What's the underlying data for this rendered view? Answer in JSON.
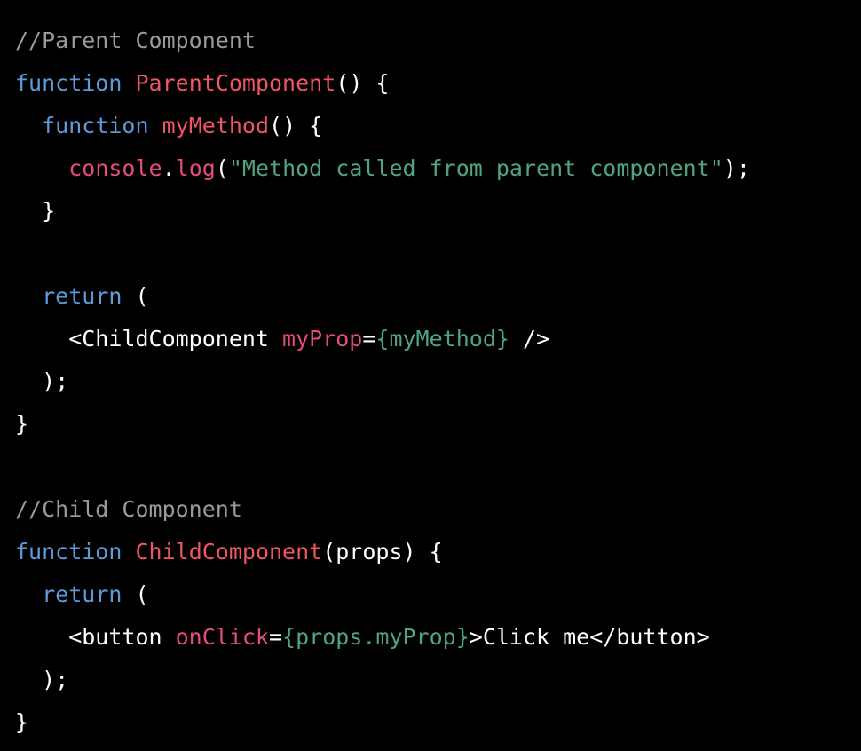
{
  "theme": {
    "background": "#000000",
    "colors": {
      "comment": "#9a9a9a",
      "keyword": "#5d9bd8",
      "function_name": "#ef5562",
      "builtin": "#e44c7c",
      "string": "#4fa481",
      "plain": "#ffffff"
    }
  },
  "code": {
    "language": "javascript",
    "lines": [
      [
        {
          "t": "//Parent Component",
          "k": "comment"
        }
      ],
      [
        {
          "t": "function",
          "k": "keyword"
        },
        {
          "t": " ",
          "k": "plain"
        },
        {
          "t": "ParentComponent",
          "k": "function_name"
        },
        {
          "t": "() {",
          "k": "plain"
        }
      ],
      [
        {
          "t": "  ",
          "k": "plain"
        },
        {
          "t": "function",
          "k": "keyword"
        },
        {
          "t": " ",
          "k": "plain"
        },
        {
          "t": "myMethod",
          "k": "function_name"
        },
        {
          "t": "() {",
          "k": "plain"
        }
      ],
      [
        {
          "t": "    ",
          "k": "plain"
        },
        {
          "t": "console",
          "k": "builtin"
        },
        {
          "t": ".",
          "k": "plain"
        },
        {
          "t": "log",
          "k": "builtin"
        },
        {
          "t": "(",
          "k": "plain"
        },
        {
          "t": "\"Method called from parent component\"",
          "k": "string"
        },
        {
          "t": ");",
          "k": "plain"
        }
      ],
      [
        {
          "t": "  }",
          "k": "plain"
        }
      ],
      [],
      [
        {
          "t": "  ",
          "k": "plain"
        },
        {
          "t": "return",
          "k": "keyword"
        },
        {
          "t": " (",
          "k": "plain"
        }
      ],
      [
        {
          "t": "    <ChildComponent ",
          "k": "plain"
        },
        {
          "t": "myProp",
          "k": "builtin"
        },
        {
          "t": "=",
          "k": "plain"
        },
        {
          "t": "{myMethod}",
          "k": "string"
        },
        {
          "t": " />",
          "k": "plain"
        }
      ],
      [
        {
          "t": "  );",
          "k": "plain"
        }
      ],
      [
        {
          "t": "}",
          "k": "plain"
        }
      ],
      [],
      [
        {
          "t": "//Child Component",
          "k": "comment"
        }
      ],
      [
        {
          "t": "function",
          "k": "keyword"
        },
        {
          "t": " ",
          "k": "plain"
        },
        {
          "t": "ChildComponent",
          "k": "function_name"
        },
        {
          "t": "(props) {",
          "k": "plain"
        }
      ],
      [
        {
          "t": "  ",
          "k": "plain"
        },
        {
          "t": "return",
          "k": "keyword"
        },
        {
          "t": " (",
          "k": "plain"
        }
      ],
      [
        {
          "t": "    <button ",
          "k": "plain"
        },
        {
          "t": "onClick",
          "k": "builtin"
        },
        {
          "t": "=",
          "k": "plain"
        },
        {
          "t": "{props.myProp}",
          "k": "string"
        },
        {
          "t": ">Click me</button>",
          "k": "plain"
        }
      ],
      [
        {
          "t": "  );",
          "k": "plain"
        }
      ],
      [
        {
          "t": "}",
          "k": "plain"
        }
      ]
    ]
  }
}
